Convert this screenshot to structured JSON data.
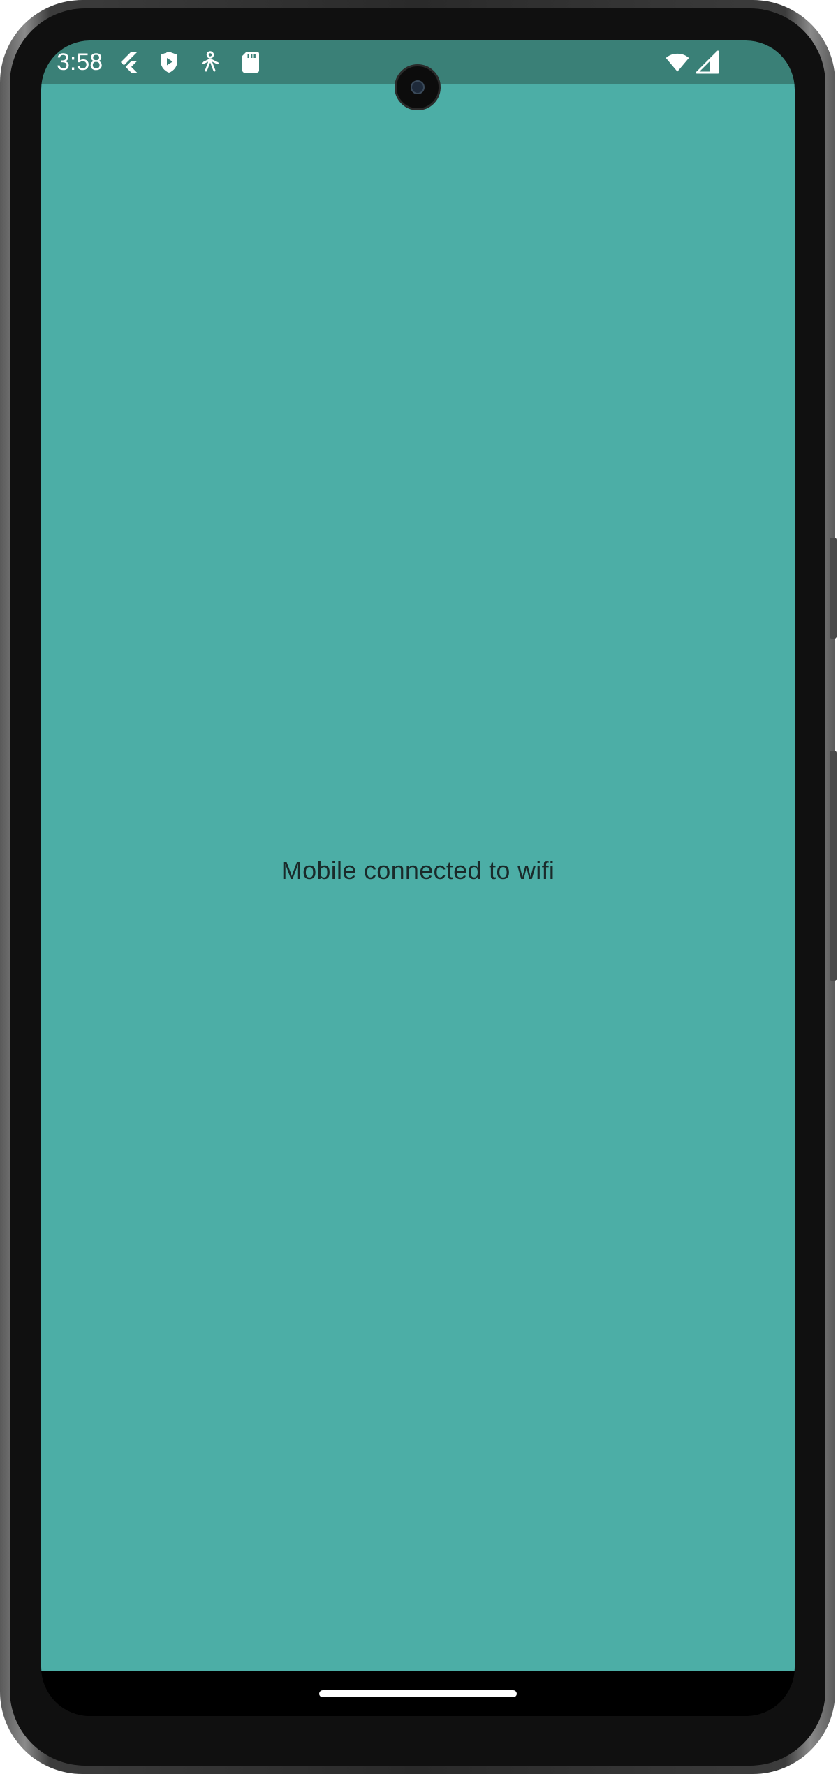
{
  "status_bar": {
    "time": "3:58",
    "left_icons": [
      "flutter-icon",
      "shield-play-icon",
      "accessibility-icon",
      "sd-card-icon"
    ],
    "right_icons": [
      "wifi-icon",
      "cellular-signal-icon"
    ],
    "background": "#3a8077"
  },
  "main": {
    "message": "Mobile connected to wifi",
    "background": "#4caea6",
    "text_color": "#1a2a2a"
  }
}
